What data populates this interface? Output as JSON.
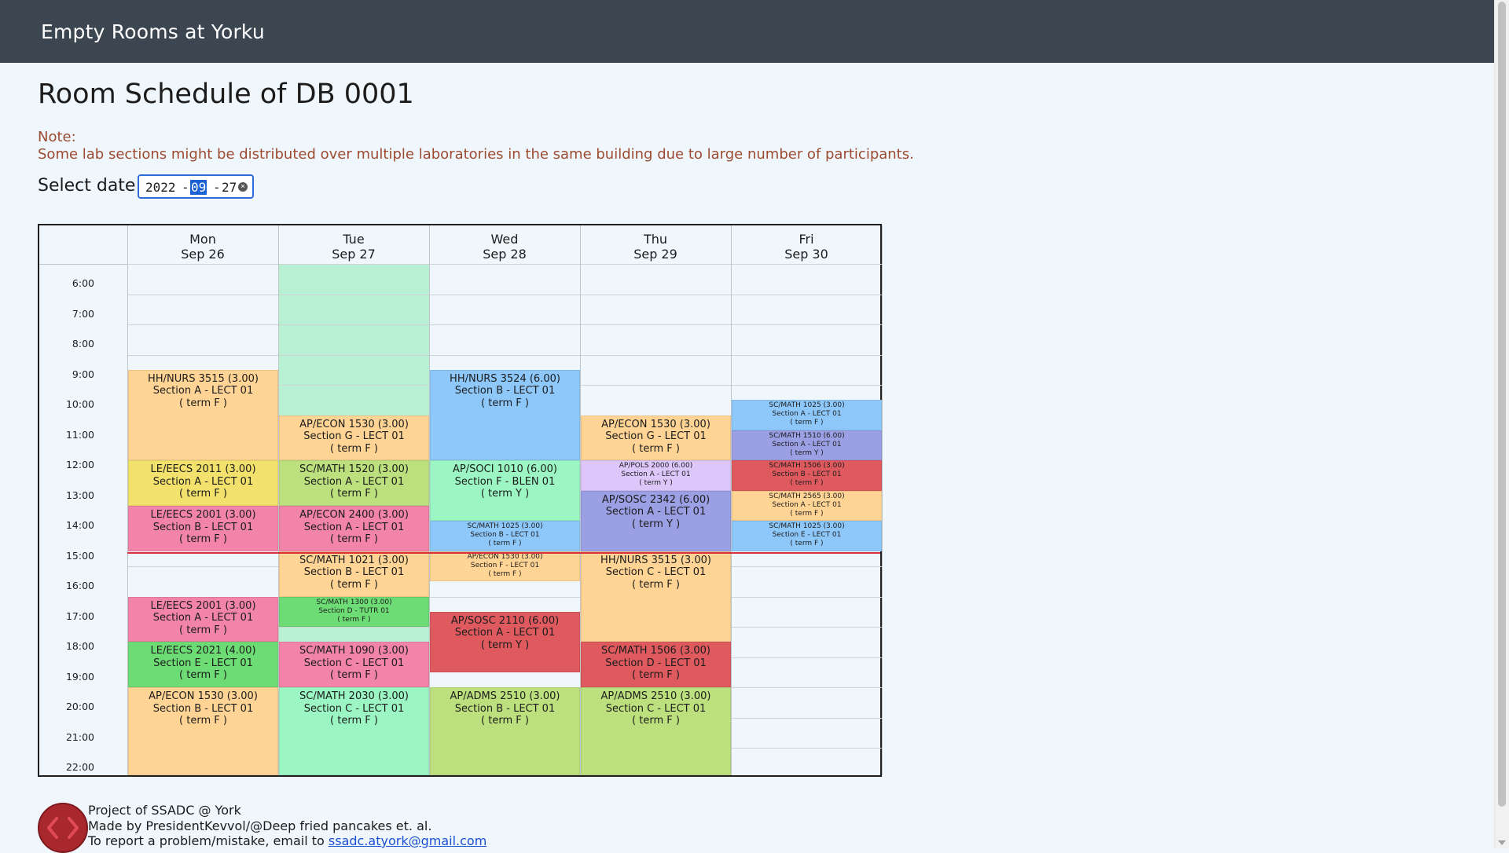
{
  "navbar": {
    "brand": "Empty Rooms at Yorku"
  },
  "page": {
    "title": "Room Schedule of DB 0001",
    "note_label": "Note:",
    "note_text": "Some lab sections might be distributed over multiple laboratories in the same building due to large number of participants."
  },
  "date_picker": {
    "label": "Select date:",
    "year": "2022",
    "sep1": "-",
    "month": "09",
    "sep2": "-",
    "day": "27",
    "clear_icon": "clear-circle-icon"
  },
  "calendar": {
    "days": [
      {
        "dow": "Mon",
        "date": "Sep 26"
      },
      {
        "dow": "Tue",
        "date": "Sep 27"
      },
      {
        "dow": "Wed",
        "date": "Sep 28"
      },
      {
        "dow": "Thu",
        "date": "Sep 29"
      },
      {
        "dow": "Fri",
        "date": "Sep 30"
      }
    ],
    "times": [
      "6:00",
      "7:00",
      "8:00",
      "9:00",
      "10:00",
      "11:00",
      "12:00",
      "13:00",
      "14:00",
      "15:00",
      "16:00",
      "17:00",
      "18:00",
      "19:00",
      "20:00",
      "21:00",
      "22:00"
    ],
    "current_time": "15:03",
    "highlight_day": "Tue",
    "events": [
      {
        "day": 0,
        "start": "9:00",
        "end": "12:00",
        "course": "HH/NURS 3515 (3.00)",
        "section": "Section A - LECT 01",
        "term": "( term F )",
        "color": "#ffd495",
        "size": "big"
      },
      {
        "day": 0,
        "start": "12:00",
        "end": "13:30",
        "course": "LE/EECS 2011 (3.00)",
        "section": "Section A - LECT 01",
        "term": "( term F )",
        "color": "#f2e26d",
        "size": "big"
      },
      {
        "day": 0,
        "start": "13:30",
        "end": "15:00",
        "course": "LE/EECS 2001 (3.00)",
        "section": "Section B - LECT 01",
        "term": "( term F )",
        "color": "#f283a9",
        "size": "big"
      },
      {
        "day": 0,
        "start": "16:30",
        "end": "18:00",
        "course": "LE/EECS 2001 (3.00)",
        "section": "Section A - LECT 01",
        "term": "( term F )",
        "color": "#f283a9",
        "size": "big"
      },
      {
        "day": 0,
        "start": "18:00",
        "end": "19:30",
        "course": "LE/EECS 2021 (4.00)",
        "section": "Section E - LECT 01",
        "term": "( term F )",
        "color": "#6ddc75",
        "size": "big"
      },
      {
        "day": 0,
        "start": "19:30",
        "end": "22:30",
        "course": "AP/ECON 1530 (3.00)",
        "section": "Section B - LECT 01",
        "term": "( term F )",
        "color": "#ffd495",
        "size": "big"
      },
      {
        "day": 1,
        "start": "10:30",
        "end": "12:00",
        "course": "AP/ECON 1530 (3.00)",
        "section": "Section G - LECT 01",
        "term": "( term F )",
        "color": "#ffd495",
        "size": "big"
      },
      {
        "day": 1,
        "start": "12:00",
        "end": "13:30",
        "course": "SC/MATH 1520 (3.00)",
        "section": "Section A - LECT 01",
        "term": "( term F )",
        "color": "#bde07e",
        "size": "big"
      },
      {
        "day": 1,
        "start": "13:30",
        "end": "15:00",
        "course": "AP/ECON 2400 (3.00)",
        "section": "Section A - LECT 01",
        "term": "( term F )",
        "color": "#f283a9",
        "size": "big"
      },
      {
        "day": 1,
        "start": "15:00",
        "end": "16:30",
        "course": "SC/MATH 1021 (3.00)",
        "section": "Section B - LECT 01",
        "term": "( term F )",
        "color": "#ffd495",
        "size": "big"
      },
      {
        "day": 1,
        "start": "16:30",
        "end": "17:30",
        "course": "SC/MATH 1300 (3.00)",
        "section": "Section D - TUTR 01",
        "term": "( term F )",
        "color": "#6ddc75",
        "size": "small"
      },
      {
        "day": 1,
        "start": "18:00",
        "end": "19:30",
        "course": "SC/MATH 1090 (3.00)",
        "section": "Section C - LECT 01",
        "term": "( term F )",
        "color": "#f283a9",
        "size": "big"
      },
      {
        "day": 1,
        "start": "19:30",
        "end": "22:30",
        "course": "SC/MATH 2030 (3.00)",
        "section": "Section C - LECT 01",
        "term": "( term F )",
        "color": "#9bf6c3",
        "size": "big"
      },
      {
        "day": 2,
        "start": "9:00",
        "end": "12:00",
        "course": "HH/NURS 3524 (6.00)",
        "section": "Section B - LECT 01",
        "term": "( term F )",
        "color": "#8ec8fa",
        "size": "big"
      },
      {
        "day": 2,
        "start": "12:00",
        "end": "14:00",
        "course": "AP/SOCI 1010 (6.00)",
        "section": "Section F - BLEN 01",
        "term": "( term Y )",
        "color": "#9bf6c3",
        "size": "big"
      },
      {
        "day": 2,
        "start": "14:00",
        "end": "15:00",
        "course": "SC/MATH 1025 (3.00)",
        "section": "Section B - LECT 01",
        "term": "( term F )",
        "color": "#8ec8fa",
        "size": "small"
      },
      {
        "day": 2,
        "start": "15:00",
        "end": "16:00",
        "course": "AP/ECON 1530 (3.00)",
        "section": "Section F - LECT 01",
        "term": "( term F )",
        "color": "#ffd495",
        "size": "small"
      },
      {
        "day": 2,
        "start": "17:00",
        "end": "19:00",
        "course": "AP/SOSC 2110 (6.00)",
        "section": "Section A - LECT 01",
        "term": "( term Y )",
        "color": "#de5a5e",
        "size": "big"
      },
      {
        "day": 2,
        "start": "19:30",
        "end": "22:30",
        "course": "AP/ADMS 2510 (3.00)",
        "section": "Section B - LECT 01",
        "term": "( term F )",
        "color": "#bde07e",
        "size": "big"
      },
      {
        "day": 3,
        "start": "10:30",
        "end": "12:00",
        "course": "AP/ECON 1530 (3.00)",
        "section": "Section G - LECT 01",
        "term": "( term F )",
        "color": "#ffd495",
        "size": "big"
      },
      {
        "day": 3,
        "start": "12:00",
        "end": "13:00",
        "course": "AP/POLS 2000 (6.00)",
        "section": "Section A - LECT 01",
        "term": "( term Y )",
        "color": "#dcc6fa",
        "size": "small"
      },
      {
        "day": 3,
        "start": "13:00",
        "end": "15:00",
        "course": "AP/SOSC 2342 (6.00)",
        "section": "Section A - LECT 01",
        "term": "( term Y )",
        "color": "#9b9fe4",
        "size": "big"
      },
      {
        "day": 3,
        "start": "15:00",
        "end": "18:00",
        "course": "HH/NURS 3515 (3.00)",
        "section": "Section C - LECT 01",
        "term": "( term F )",
        "color": "#ffd495",
        "size": "big"
      },
      {
        "day": 3,
        "start": "18:00",
        "end": "19:30",
        "course": "SC/MATH 1506 (3.00)",
        "section": "Section D - LECT 01",
        "term": "( term F )",
        "color": "#de5a5e",
        "size": "big"
      },
      {
        "day": 3,
        "start": "19:30",
        "end": "22:30",
        "course": "AP/ADMS 2510 (3.00)",
        "section": "Section C - LECT 01",
        "term": "( term F )",
        "color": "#bde07e",
        "size": "big"
      },
      {
        "day": 4,
        "start": "10:00",
        "end": "11:00",
        "course": "SC/MATH 1025 (3.00)",
        "section": "Section A - LECT 01",
        "term": "( term F )",
        "color": "#8ec8fa",
        "size": "small"
      },
      {
        "day": 4,
        "start": "11:00",
        "end": "12:00",
        "course": "SC/MATH 1510 (6.00)",
        "section": "Section A - LECT 01",
        "term": "( term Y )",
        "color": "#9b9fe4",
        "size": "small"
      },
      {
        "day": 4,
        "start": "12:00",
        "end": "13:00",
        "course": "SC/MATH 1506 (3.00)",
        "section": "Section B - LECT 01",
        "term": "( term F )",
        "color": "#de5a5e",
        "size": "small"
      },
      {
        "day": 4,
        "start": "13:00",
        "end": "14:00",
        "course": "SC/MATH 2565 (3.00)",
        "section": "Section A - LECT 01",
        "term": "( term F )",
        "color": "#ffd495",
        "size": "small"
      },
      {
        "day": 4,
        "start": "14:00",
        "end": "15:00",
        "course": "SC/MATH 1025 (3.00)",
        "section": "Section E - LECT 01",
        "term": "( term F )",
        "color": "#8ec8fa",
        "size": "small"
      }
    ]
  },
  "footer": {
    "logo_icon": "code-brackets-icon",
    "line1": "Project of SSADC @ York",
    "line2": "Made by PresidentKevvol/@Deep fried pancakes et. al.",
    "line3_prefix": "To report a problem/mistake, email to ",
    "email": "ssadc.atyork@gmail.com",
    "email_href": "mailto:ssadc.atyork@gmail.com"
  }
}
